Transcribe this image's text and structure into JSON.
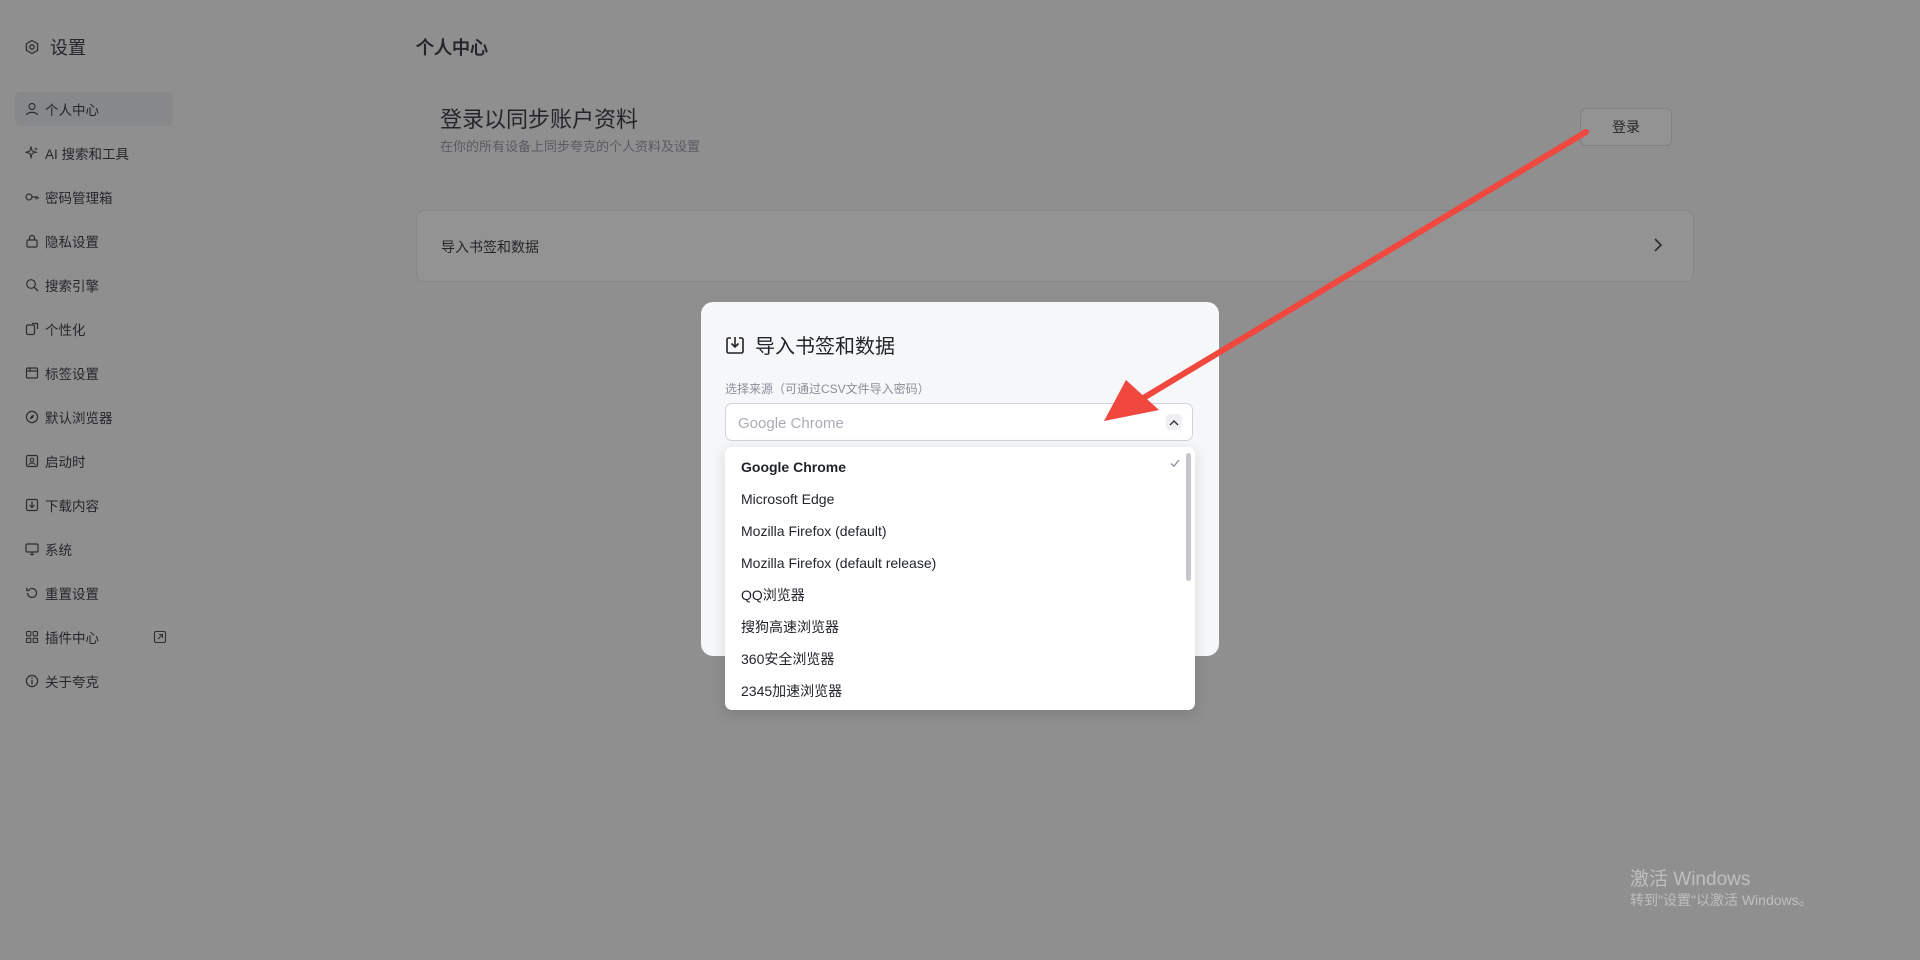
{
  "sidebar": {
    "header": "设置",
    "items": [
      {
        "label": "个人中心",
        "icon": "user-icon"
      },
      {
        "label": "AI 搜索和工具",
        "icon": "sparkle-icon"
      },
      {
        "label": "密码管理箱",
        "icon": "key-icon"
      },
      {
        "label": "隐私设置",
        "icon": "lock-icon"
      },
      {
        "label": "搜索引擎",
        "icon": "search-icon"
      },
      {
        "label": "个性化",
        "icon": "palette-icon"
      },
      {
        "label": "标签设置",
        "icon": "tab-icon"
      },
      {
        "label": "默认浏览器",
        "icon": "compass-icon"
      },
      {
        "label": "启动时",
        "icon": "startup-icon"
      },
      {
        "label": "下载内容",
        "icon": "download-icon"
      },
      {
        "label": "系统",
        "icon": "monitor-icon"
      },
      {
        "label": "重置设置",
        "icon": "reset-icon"
      },
      {
        "label": "插件中心",
        "icon": "grid-icon"
      },
      {
        "label": "关于夸克",
        "icon": "info-icon"
      }
    ]
  },
  "main": {
    "page_title": "个人中心",
    "login": {
      "title": "登录以同步账户资料",
      "subtitle": "在你的所有设备上同步夸克的个人资料及设置",
      "button": "登录"
    },
    "import_card": {
      "label": "导入书签和数据"
    }
  },
  "dialog": {
    "title": "导入书签和数据",
    "source_label": "选择来源（可通过CSV文件导入密码）",
    "selected": "Google Chrome",
    "options": [
      "Google Chrome",
      "Microsoft Edge",
      "Mozilla Firefox (default)",
      "Mozilla Firefox (default release)",
      "QQ浏览器",
      "搜狗高速浏览器",
      "360安全浏览器",
      "2345加速浏览器"
    ]
  },
  "watermark": {
    "line1": "激活 Windows",
    "line2": "转到\"设置\"以激活 Windows。"
  },
  "colors": {
    "arrow": "#f0473f",
    "overlay": "#808080"
  }
}
